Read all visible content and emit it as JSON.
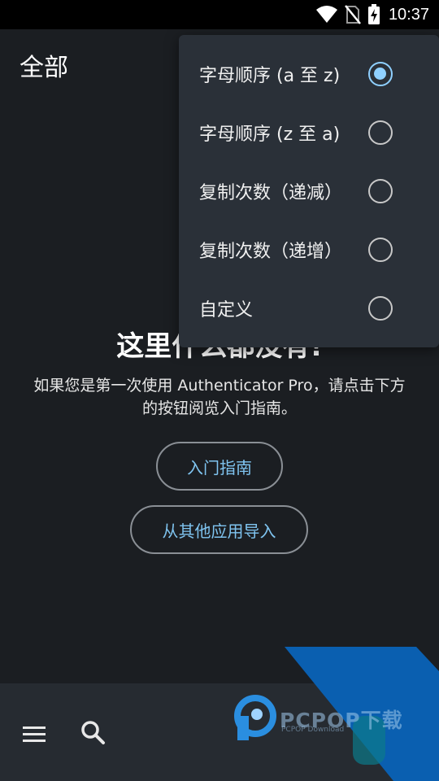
{
  "status_bar": {
    "time": "10:37",
    "icons": [
      "wifi-icon",
      "no-sim-icon",
      "battery-charging-icon"
    ]
  },
  "app_bar": {
    "title": "全部"
  },
  "empty_state": {
    "title": "这里什么都没有!",
    "description": "如果您是第一次使用 Authenticator Pro，请点击下方的按钮阅览入门指南。",
    "guide_button": "入门指南",
    "import_button": "从其他应用导入"
  },
  "sort_menu": {
    "items": [
      {
        "label": "字母顺序 (a 至 z)",
        "selected": true
      },
      {
        "label": "字母顺序 (z 至 a)",
        "selected": false
      },
      {
        "label": "复制次数（递减）",
        "selected": false
      },
      {
        "label": "复制次数（递增）",
        "selected": false
      },
      {
        "label": "自定义",
        "selected": false
      }
    ]
  },
  "bottom_bar": {
    "icons": [
      "menu-icon",
      "search-icon"
    ]
  },
  "watermark": {
    "text": "PCPOP下载",
    "sub": "PCPOP Download"
  },
  "colors": {
    "background": "#1b1e22",
    "accent": "#8fd0ff",
    "button_text": "#7fc4f0",
    "menu_background": "#2a3038",
    "bottom_bar": "#262b31"
  }
}
